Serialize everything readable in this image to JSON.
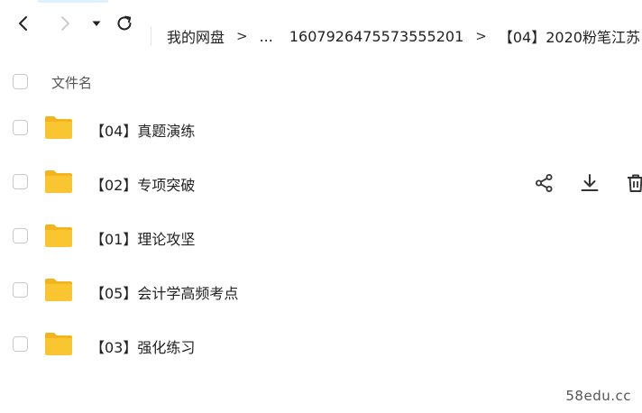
{
  "toolbar": {
    "back_icon": "chevron-left-icon",
    "forward_icon": "chevron-right-icon",
    "dropdown_icon": "caret-down-icon",
    "refresh_icon": "refresh-icon"
  },
  "breadcrumb": {
    "root": "我的网盘",
    "sep": ">",
    "ellipsis": "...",
    "level1": "1607926475573555201",
    "current": "【04】2020粉笔江苏"
  },
  "list": {
    "header_label": "文件名",
    "files": [
      {
        "name": "【04】真题演练",
        "type": "folder"
      },
      {
        "name": "【02】专项突破",
        "type": "folder"
      },
      {
        "name": "【01】理论攻坚",
        "type": "folder"
      },
      {
        "name": "【05】会计学高频考点",
        "type": "folder"
      },
      {
        "name": "【03】强化练习",
        "type": "folder"
      }
    ],
    "hover_actions": [
      "share-icon",
      "download-icon",
      "delete-icon"
    ]
  },
  "colors": {
    "folder": "#f9c531",
    "folder_dark": "#f3b41c",
    "icon": "#333333",
    "disabled_icon": "#bdbdbd"
  },
  "watermark": "58edu.cc"
}
